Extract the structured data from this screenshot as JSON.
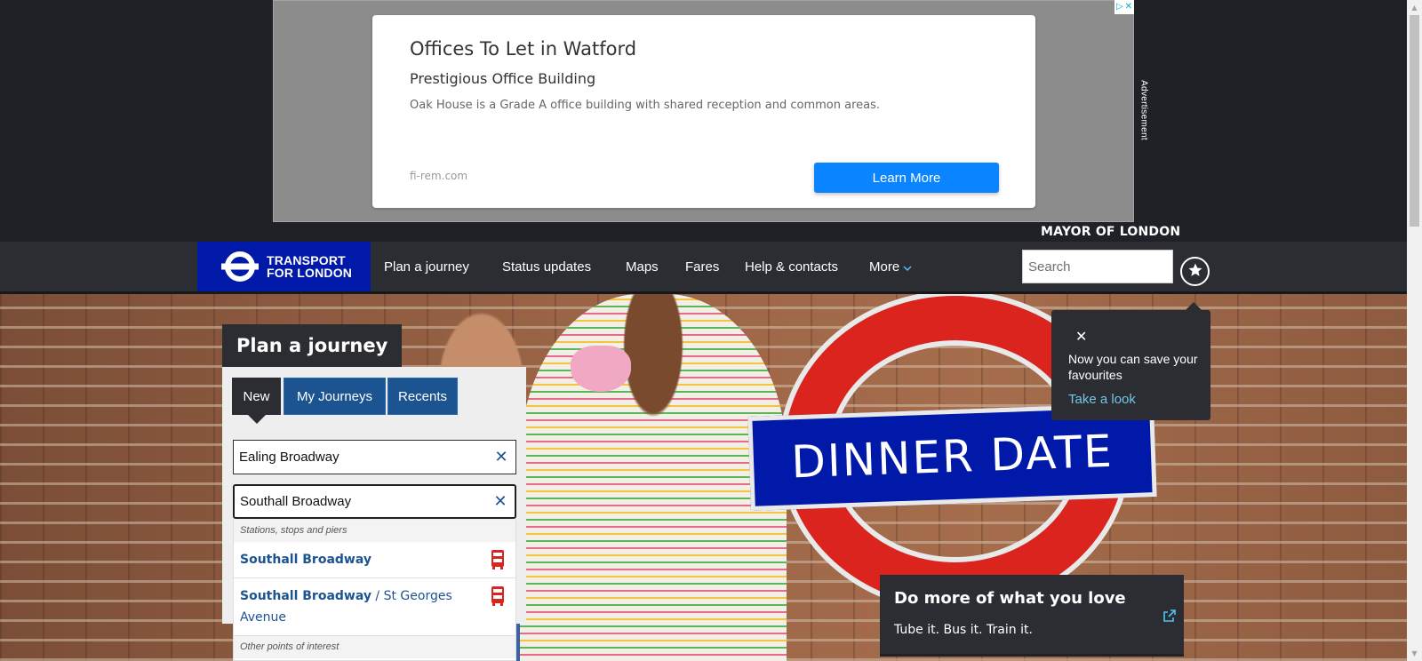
{
  "ad": {
    "title": "Offices To Let in Watford",
    "subtitle": "Prestigious Office Building",
    "description": "Oak House is a Grade A office building with shared reception and common areas.",
    "domain": "fi-rem.com",
    "cta": "Learn More",
    "side_label": "Advertisement",
    "choices_icon": "adchoices-icon",
    "close_icon": "close-icon"
  },
  "header": {
    "mayor": "MAYOR OF LONDON",
    "logo_line1": "TRANSPORT",
    "logo_line2": "FOR LONDON",
    "nav": [
      "Plan a journey",
      "Status updates",
      "Maps",
      "Fares",
      "Help & contacts",
      "More"
    ],
    "search_placeholder": "Search",
    "favourites_icon": "star-icon"
  },
  "planner": {
    "heading": "Plan a journey",
    "tabs": [
      "New",
      "My Journeys",
      "Recents"
    ],
    "active_tab": "New",
    "from_value": "Ealing Broadway",
    "to_value": "Southall Broadway",
    "dropdown": {
      "group1": "Stations, stops and piers",
      "items": [
        {
          "main": "Southall Broadway",
          "sub": ""
        },
        {
          "main": "Southall Broadway",
          "separator": " / ",
          "sub": "St Georges Avenue"
        }
      ],
      "group2": "Other points of interest"
    }
  },
  "hero": {
    "sign_text": "DINNER DATE"
  },
  "favourites_tip": {
    "message": "Now you can save your favourites",
    "link": "Take a look"
  },
  "promo": {
    "title": "Do more of what you love",
    "subtitle": "Tube it. Bus it. Train it."
  },
  "colors": {
    "tfl_blue": "#0019a8",
    "tfl_red": "#dc241f",
    "nav_dark": "#2b2d33",
    "tab_blue": "#1c5391",
    "ad_button": "#0a84ff"
  }
}
